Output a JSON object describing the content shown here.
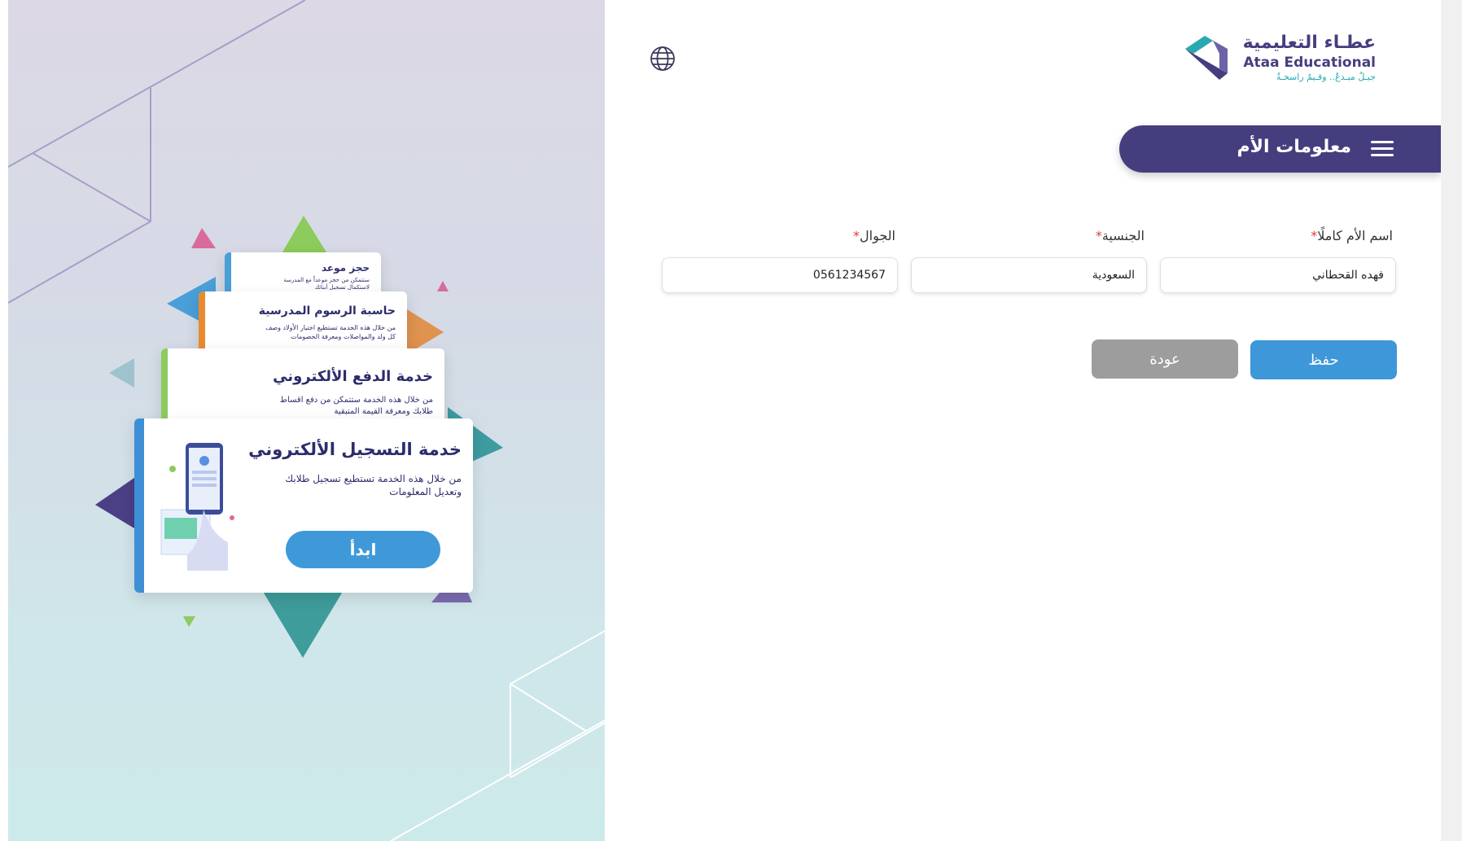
{
  "logo": {
    "arabic": "عطـاء التعليمية",
    "english": "Ataa Educational",
    "tagline": "جيـلٌ مبـدعٌ.. وقـيمٌ راسخـةٌ"
  },
  "header": {
    "title": "معلومات الأم"
  },
  "form": {
    "name_label": "اسم الأم كاملًا",
    "name_value": "فهده القحطاني",
    "nationality_label": "الجنسية",
    "nationality_value": "السعودية",
    "mobile_label": "الجوال",
    "mobile_value": "0561234567",
    "required_mark": "*"
  },
  "actions": {
    "save_label": "حفظ",
    "back_label": "عودة"
  },
  "promo_cards": [
    {
      "title": "حجز موعد",
      "desc": "ستتمكن من حجز موعداً مع المدرسة لاستكمال تسجيل أبنائك"
    },
    {
      "title": "حاسبة الرسوم المدرسية",
      "desc": "من خلال هذه الخدمة تستطيع اختيار الأولاد وصف كل ولد والمواصلات ومعرفة الخصومات"
    },
    {
      "title": "خدمة الدفع الألكتروني",
      "desc": "من خلال هذه الخدمة ستتمكن من دفع اقساط طلابك ومعرفة القيمة المتبقية"
    },
    {
      "title": "خدمة التسجيل الألكتروني",
      "desc": "من خلال هذه الخدمة تستطيع تسجيل طلابك وتعديل المعلومات",
      "button": "ابدأ"
    }
  ],
  "colors": {
    "brand_purple": "#453e7e",
    "save_blue": "#3d97d9",
    "back_gray": "#9d9d9d",
    "required_red": "#e53935"
  }
}
